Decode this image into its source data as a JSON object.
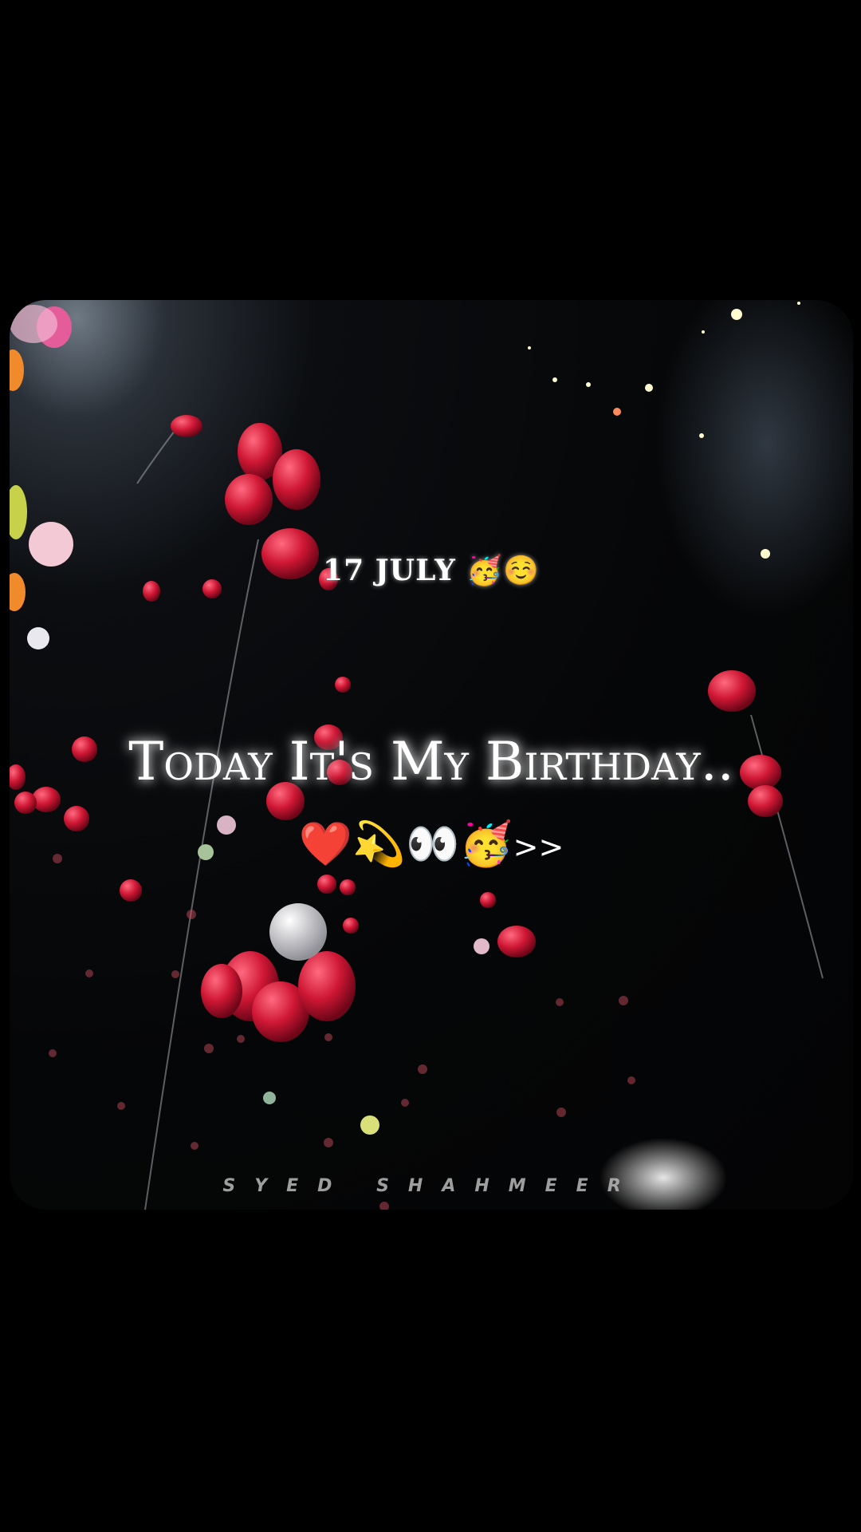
{
  "video": {
    "date_line": "17 JULY 🥳☺️",
    "headline": "Today It's My Birthday..",
    "emoji_line": "❤️💫👀🥳",
    "emoji_suffix": ">>",
    "watermark": "SYED SHAHMEER"
  },
  "colors": {
    "background": "#000000",
    "balloon_red": "#d41c3c",
    "text": "#ffffff"
  }
}
